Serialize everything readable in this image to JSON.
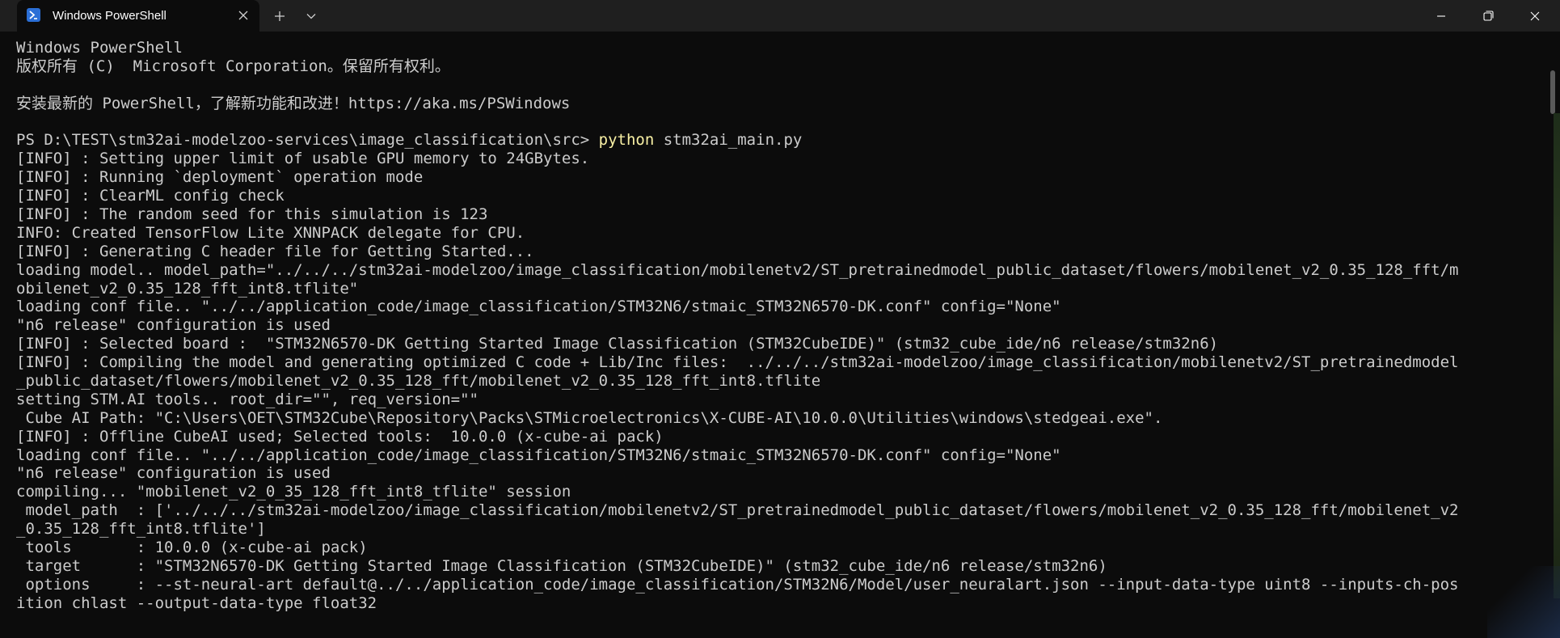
{
  "window": {
    "tab_title": "Windows PowerShell",
    "icons": {
      "app": "powershell-icon",
      "tab_close": "close-icon",
      "new_tab": "plus-icon",
      "dropdown": "chevron-down-icon",
      "minimize": "minimize-icon",
      "maximize": "restore-icon",
      "close": "close-icon"
    }
  },
  "colors": {
    "background": "#0c0c0c",
    "titlebar": "#1f1f1f",
    "text": "#cccccc",
    "command": "#f9f1a5"
  },
  "terminal": {
    "lines": [
      "Windows PowerShell",
      "版权所有 (C)  Microsoft Corporation。保留所有权利。",
      "",
      "安装最新的 PowerShell，了解新功能和改进！https://aka.ms/PSWindows",
      "",
      "",
      "[INFO] : Setting upper limit of usable GPU memory to 24GBytes.",
      "[INFO] : Running `deployment` operation mode",
      "[INFO] : ClearML config check",
      "[INFO] : The random seed for this simulation is 123",
      "INFO: Created TensorFlow Lite XNNPACK delegate for CPU.",
      "[INFO] : Generating C header file for Getting Started...",
      "loading model.. model_path=\"../../../stm32ai-modelzoo/image_classification/mobilenetv2/ST_pretrainedmodel_public_dataset/flowers/mobilenet_v2_0.35_128_fft/m",
      "obilenet_v2_0.35_128_fft_int8.tflite\"",
      "loading conf file.. \"../../application_code/image_classification/STM32N6/stmaic_STM32N6570-DK.conf\" config=\"None\"",
      "\"n6 release\" configuration is used",
      "[INFO] : Selected board :  \"STM32N6570-DK Getting Started Image Classification (STM32CubeIDE)\" (stm32_cube_ide/n6 release/stm32n6)",
      "[INFO] : Compiling the model and generating optimized C code + Lib/Inc files:  ../../../stm32ai-modelzoo/image_classification/mobilenetv2/ST_pretrainedmodel",
      "_public_dataset/flowers/mobilenet_v2_0.35_128_fft/mobilenet_v2_0.35_128_fft_int8.tflite",
      "setting STM.AI tools.. root_dir=\"\", req_version=\"\"",
      " Cube AI Path: \"C:\\Users\\OET\\STM32Cube\\Repository\\Packs\\STMicroelectronics\\X-CUBE-AI\\10.0.0\\Utilities\\windows\\stedgeai.exe\".",
      "[INFO] : Offline CubeAI used; Selected tools:  10.0.0 (x-cube-ai pack)",
      "loading conf file.. \"../../application_code/image_classification/STM32N6/stmaic_STM32N6570-DK.conf\" config=\"None\"",
      "\"n6 release\" configuration is used",
      "compiling... \"mobilenet_v2_0_35_128_fft_int8_tflite\" session",
      " model_path  : ['../../../stm32ai-modelzoo/image_classification/mobilenetv2/ST_pretrainedmodel_public_dataset/flowers/mobilenet_v2_0.35_128_fft/mobilenet_v2",
      "_0.35_128_fft_int8.tflite']",
      " tools       : 10.0.0 (x-cube-ai pack)",
      " target      : \"STM32N6570-DK Getting Started Image Classification (STM32CubeIDE)\" (stm32_cube_ide/n6 release/stm32n6)",
      " options     : --st-neural-art default@../../application_code/image_classification/STM32N6/Model/user_neuralart.json --input-data-type uint8 --inputs-ch-pos",
      "ition chlast --output-data-type float32"
    ],
    "prompt": "PS D:\\TEST\\stm32ai-modelzoo-services\\image_classification\\src> ",
    "command": "python",
    "command_args": " stm32ai_main.py"
  }
}
